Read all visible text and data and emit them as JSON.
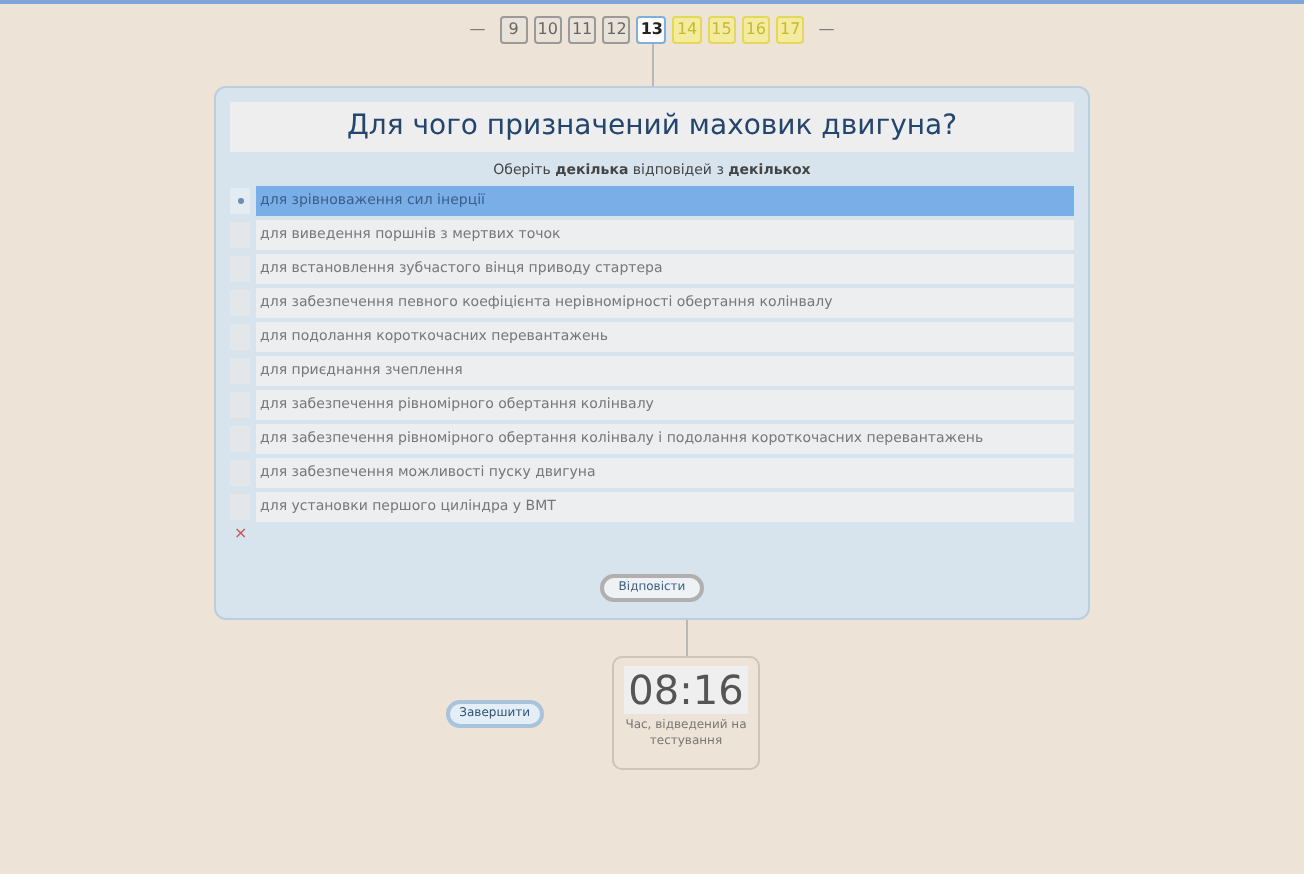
{
  "pagination": {
    "prev": "—",
    "next": "—",
    "pages": [
      {
        "label": "9",
        "kind": "answered"
      },
      {
        "label": "10",
        "kind": "answered"
      },
      {
        "label": "11",
        "kind": "answered"
      },
      {
        "label": "12",
        "kind": "answered"
      },
      {
        "label": "13",
        "kind": "current"
      },
      {
        "label": "14",
        "kind": "pending"
      },
      {
        "label": "15",
        "kind": "pending"
      },
      {
        "label": "16",
        "kind": "pending"
      },
      {
        "label": "17",
        "kind": "pending"
      }
    ]
  },
  "question": {
    "title": "Для чого призначений маховик двигуна?",
    "instruction": "Оберіть **декілька** відповідей з **декількох**",
    "options": [
      {
        "text": "для зрівноваження сил інерції",
        "selected": true
      },
      {
        "text": "для виведення поршнів з мертвих точок",
        "selected": false
      },
      {
        "text": "для встановлення зубчастого вінця приводу стартера",
        "selected": false
      },
      {
        "text": "для забезпечення певного коефіцієнта нерівномірності обертання колінвалу",
        "selected": false
      },
      {
        "text": "для подолання короткочасних перевантажень",
        "selected": false
      },
      {
        "text": "для приєднання зчеплення",
        "selected": false
      },
      {
        "text": "для забезпечення рівномірного обертання колінвалу",
        "selected": false
      },
      {
        "text": "для забезпечення рівномірного обертання колінвалу і подолання короткочасних перевантажень",
        "selected": false
      },
      {
        "text": "для забезпечення можливості пуску двигуна",
        "selected": false
      },
      {
        "text": "для установки першого циліндра у ВМТ",
        "selected": false
      }
    ],
    "clear": "×",
    "submit": "Відповісти"
  },
  "finish": "Завершити",
  "timer": {
    "time": "08:16",
    "caption": "Час, відведений на тестування"
  }
}
